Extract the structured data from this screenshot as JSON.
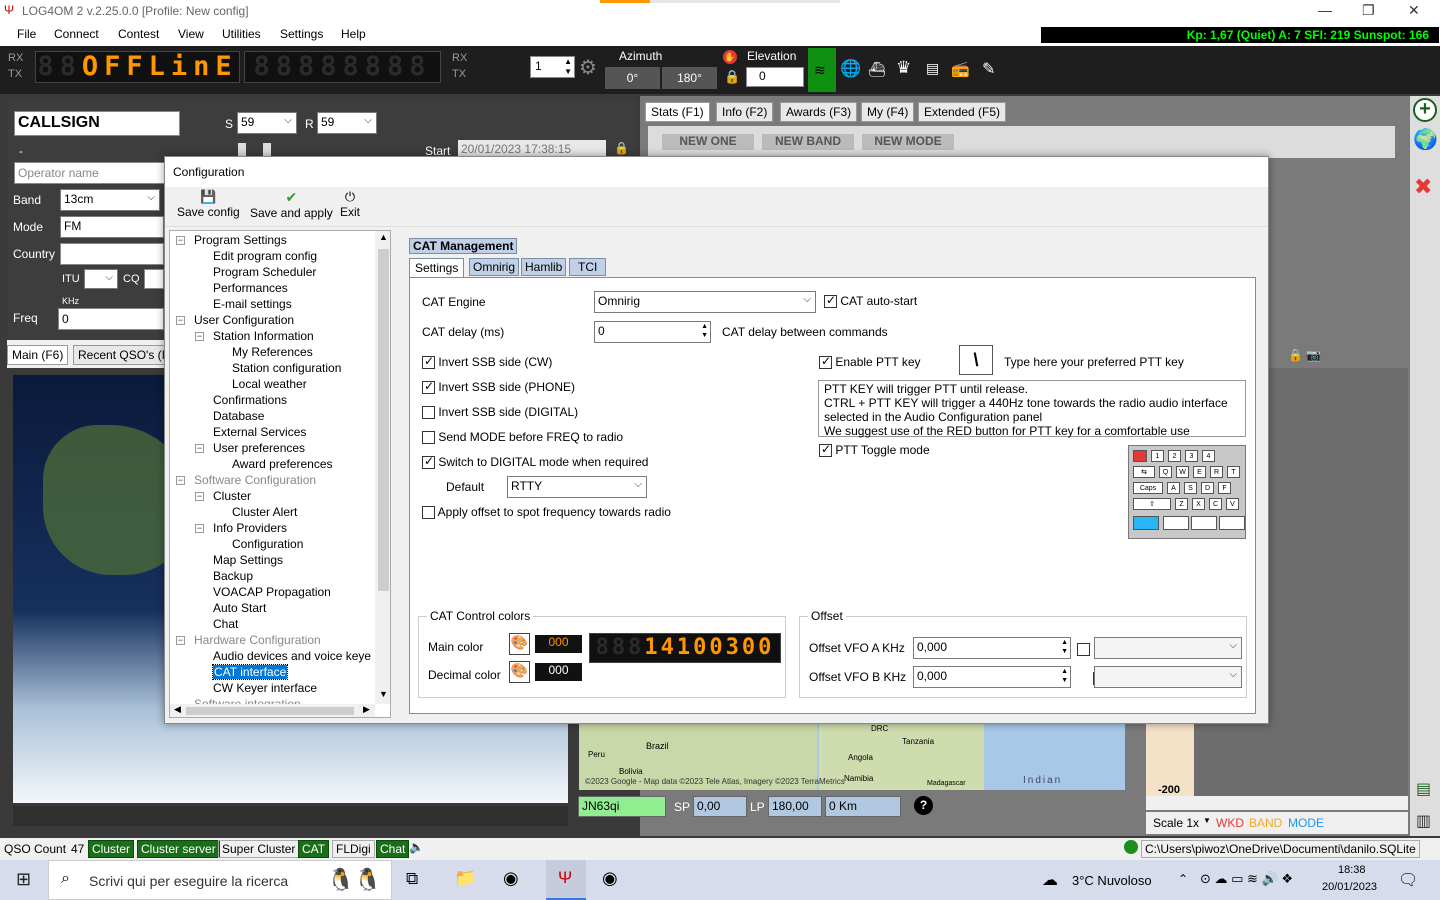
{
  "window": {
    "title": "LOG4OM 2 v.2.25.0.0 [Profile: New config]",
    "min": "—",
    "max": "❐",
    "close": "✕"
  },
  "menu": [
    "File",
    "Connect",
    "Contest",
    "View",
    "Utilities",
    "Settings",
    "Help"
  ],
  "infobar": "Kp: 1,67 (Quiet)  A: 7  SFI: 219 Sunspot: 166",
  "topbar": {
    "rx": "RX",
    "tx": "TX",
    "led_dim_left": "88",
    "led_text": "OFFLinE",
    "led_right": "88888888",
    "spinner_value": "1",
    "azimuth_label": "Azimuth",
    "az_sp": "0°",
    "az_lp": "180°",
    "elevation_label": "Elevation",
    "elevation_value": "0"
  },
  "qso": {
    "callsign": "CALLSIGN",
    "s_label": "S",
    "s_value": "59",
    "r_label": "R",
    "r_value": "59",
    "dash": "-",
    "start_label": "Start",
    "start_value": "20/01/2023 17:38:15",
    "operator_placeholder": "Operator name",
    "band_label": "Band",
    "band_value": "13cm",
    "mode_label": "Mode",
    "mode_value": "FM",
    "country_label": "Country",
    "itu_label": "ITU",
    "cq_label": "CQ",
    "khz_label": "KHz",
    "freq_label": "Freq",
    "freq_value": "0"
  },
  "right_tabs": [
    "Stats (F1)",
    "Info (F2)",
    "Awards (F3)",
    "My (F4)",
    "Extended (F5)"
  ],
  "stat_buttons": [
    "NEW ONE",
    "NEW BAND",
    "NEW MODE"
  ],
  "lower_tabs": [
    "Main (F6)",
    "Recent QSO's (I"
  ],
  "dialog": {
    "title": "Configuration",
    "toolbar": {
      "save": "Save config",
      "apply": "Save and apply",
      "exit": "Exit"
    },
    "tree": [
      {
        "t": "Program Settings",
        "lvl": 0,
        "exp": true
      },
      {
        "t": "Edit program config",
        "lvl": 1
      },
      {
        "t": "Program Scheduler",
        "lvl": 1
      },
      {
        "t": "Performances",
        "lvl": 1
      },
      {
        "t": "E-mail settings",
        "lvl": 1
      },
      {
        "t": "User Configuration",
        "lvl": 0,
        "exp": true
      },
      {
        "t": "Station Information",
        "lvl": 1,
        "exp": true
      },
      {
        "t": "My References",
        "lvl": 2
      },
      {
        "t": "Station configuration",
        "lvl": 2
      },
      {
        "t": "Local weather",
        "lvl": 2
      },
      {
        "t": "Confirmations",
        "lvl": 1
      },
      {
        "t": "Database",
        "lvl": 1
      },
      {
        "t": "External Services",
        "lvl": 1
      },
      {
        "t": "User preferences",
        "lvl": 1,
        "exp": true
      },
      {
        "t": "Award preferences",
        "lvl": 2
      },
      {
        "t": "Software Configuration",
        "lvl": 0,
        "exp": true,
        "grey": true
      },
      {
        "t": "Cluster",
        "lvl": 1,
        "exp": true
      },
      {
        "t": "Cluster Alert",
        "lvl": 2
      },
      {
        "t": "Info Providers",
        "lvl": 1,
        "exp": true
      },
      {
        "t": "Configuration",
        "lvl": 2
      },
      {
        "t": "Map Settings",
        "lvl": 1
      },
      {
        "t": "Backup",
        "lvl": 1
      },
      {
        "t": "VOACAP Propagation",
        "lvl": 1
      },
      {
        "t": "Auto Start",
        "lvl": 1
      },
      {
        "t": "Chat",
        "lvl": 1
      },
      {
        "t": "Hardware Configuration",
        "lvl": 0,
        "exp": true,
        "grey": true
      },
      {
        "t": "Audio devices and voice keye",
        "lvl": 1
      },
      {
        "t": "CAT interface",
        "lvl": 1,
        "sel": true
      },
      {
        "t": "CW Keyer interface",
        "lvl": 1
      },
      {
        "t": "Software integration",
        "lvl": 0,
        "grey": true
      }
    ],
    "section_title": "CAT Management",
    "tabs": [
      "Settings",
      "Omnirig",
      "Hamlib",
      "TCI"
    ],
    "cat_engine_label": "CAT Engine",
    "cat_engine_value": "Omnirig",
    "cat_autostart": "CAT auto-start",
    "cat_delay_label": "CAT delay (ms)",
    "cat_delay_value": "0",
    "cat_delay_desc": "CAT delay between commands",
    "invert_cw": "Invert SSB side (CW)",
    "invert_phone": "Invert SSB side (PHONE)",
    "invert_digital": "Invert SSB side (DIGITAL)",
    "send_mode": "Send MODE before FREQ to radio",
    "switch_digital": "Switch to DIGITAL mode when required",
    "default_label": "Default",
    "default_value": "RTTY",
    "apply_offset": "Apply offset to spot frequency towards radio",
    "enable_ptt": "Enable PTT key",
    "ptt_key": "\\",
    "ptt_hint": "Type here your preferred PTT key",
    "ptt_info": [
      "PTT KEY will trigger PTT until release.",
      "CTRL + PTT KEY will trigger a 440Hz tone towards the radio audio interface",
      "selected in the Audio Configuration panel",
      "We suggest use of the RED button for PTT key for a comfortable use"
    ],
    "ptt_toggle": "PTT Toggle mode",
    "colors_group": "CAT Control colors",
    "main_color_label": "Main color",
    "main_color_value": "000",
    "decimal_color_label": "Decimal color",
    "decimal_color_value": "000",
    "freq_led_dim": "888",
    "freq_led": "14100300",
    "offset_group": "Offset",
    "offset_a_label": "Offset VFO A KHz",
    "offset_a_value": "0,000",
    "offset_b_label": "Offset VFO B KHz",
    "offset_b_value": "0,000"
  },
  "keyboard": {
    "row1": [
      "1",
      "2",
      "3",
      "4"
    ],
    "row2": [
      "Q",
      "W",
      "E",
      "R",
      "T"
    ],
    "row3": [
      "A",
      "S",
      "D",
      "F"
    ],
    "row4": [
      "Z",
      "X",
      "C",
      "V"
    ],
    "caps": "Caps"
  },
  "map": {
    "labels": [
      "Brazil",
      "Peru",
      "Bolivia",
      "DRC",
      "Tanzania",
      "Angola",
      "Namibia",
      "Madagascar",
      "Indian"
    ],
    "copyright": "©2023 Google - Map data ©2023 Tele Atlas, Imagery ©2023 TerraMetrics"
  },
  "locator": {
    "grid": "JN63qi",
    "sp_label": "SP",
    "sp": "0,00",
    "lp_label": "LP",
    "lp": "180,00",
    "dist": "0 Km",
    "help": "?"
  },
  "scale": {
    "label": "Scale 1x",
    "wkd": "WKD",
    "band": "BAND",
    "mode": "MODE",
    "tick": "-200"
  },
  "statusbar": {
    "count_label": "QSO Count",
    "count": "47",
    "buttons": [
      "Cluster",
      "Cluster server",
      "Super Cluster",
      "CAT",
      "FLDigi",
      "Chat"
    ],
    "path": "C:\\Users\\piwoz\\OneDrive\\Documenti\\danilo.SQLite"
  },
  "taskbar": {
    "search": "Scrivi qui per eseguire la ricerca",
    "weather": "3°C  Nuvoloso",
    "time": "18:38",
    "date": "20/01/2023"
  },
  "colors": {
    "accent_green": "#1a6e1a",
    "led_orange": "#ff9800",
    "selection": "#0078d7"
  }
}
